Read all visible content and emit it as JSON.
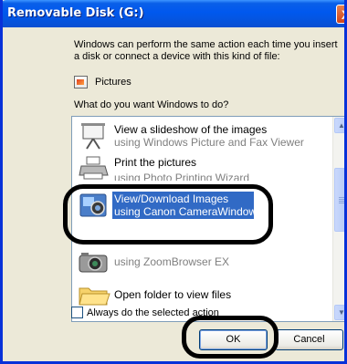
{
  "window": {
    "title": "Removable Disk (G:)",
    "close_glyph": "X"
  },
  "dialog": {
    "description_line1": "Windows can perform the same action each time you insert",
    "description_line2": "a disk or connect a device with this kind of file:",
    "content_type_label": "Pictures",
    "question": "What do you want Windows to do?"
  },
  "actions": [
    {
      "primary": "View a slideshow of the images",
      "secondary": "using Windows Picture and Fax Viewer",
      "icon": "slideshow-projector-icon"
    },
    {
      "primary": "Print the pictures",
      "secondary": "using Photo Printing Wizard",
      "icon": "printer-icon"
    },
    {
      "primary": "View/Download Images",
      "secondary": "using Canon CameraWindow",
      "icon": "canon-camerawindow-icon",
      "selected": true
    },
    {
      "primary": "",
      "secondary": "using ZoomBrowser EX",
      "icon": "camera-icon"
    },
    {
      "primary": "Open folder to view files",
      "secondary": "",
      "icon": "folder-icon"
    }
  ],
  "scrollbar": {
    "up_glyph": "▲",
    "down_glyph": "▼"
  },
  "checkbox": {
    "label": "Always do the selected action",
    "checked": false
  },
  "buttons": {
    "ok_label": "OK",
    "cancel_label": "Cancel"
  },
  "colors": {
    "titlebar": "#0058ee",
    "selection": "#316ac5",
    "window_face": "#ece9d8",
    "highlight_ring": "#000000"
  }
}
